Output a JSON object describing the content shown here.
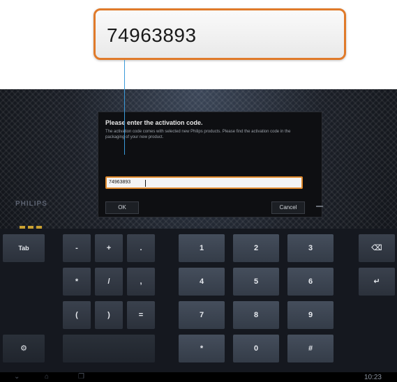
{
  "callout": {
    "text": "74963893"
  },
  "dialog": {
    "title": "Please enter the activation code.",
    "message": "The activation code comes with selected new Philips products. Please find the activation code in the packaging of your new product.",
    "input_value": "74963893",
    "ok_label": "OK",
    "cancel_label": "Cancel"
  },
  "brand": "PHILIPS",
  "keyboard": {
    "tab_label": "Tab",
    "rows": [
      [
        "-",
        "+",
        "."
      ],
      [
        "*",
        "/",
        ","
      ],
      [
        "(",
        ")",
        "="
      ]
    ],
    "numpad": [
      [
        "1",
        "2",
        "3"
      ],
      [
        "4",
        "5",
        "6"
      ],
      [
        "7",
        "8",
        "9"
      ],
      [
        "*",
        "0",
        "#"
      ]
    ]
  },
  "statusbar": {
    "clock": "10:23"
  },
  "icons": {
    "backspace": "backspace-icon",
    "enter": "enter-icon",
    "settings": "settings-icon",
    "back": "back-icon",
    "home": "home-icon",
    "recent": "recent-apps-icon"
  },
  "colors": {
    "accent": "#e07a2a",
    "leader": "#3a9ad9"
  }
}
